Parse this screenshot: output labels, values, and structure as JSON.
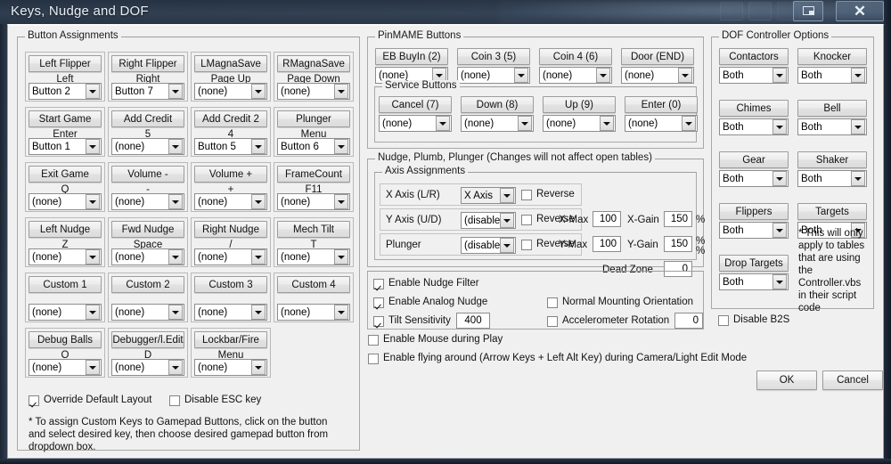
{
  "window": {
    "title": "Keys, Nudge and DOF",
    "buttons": {
      "minimize": "—",
      "maximize": "□",
      "extra": "⬜",
      "restore": "restore-icon",
      "close": "✕"
    }
  },
  "button_assignments": {
    "legend": "Button Assignments",
    "cells": [
      {
        "button": "Left Flipper",
        "key": "Left",
        "combo": "Button 2"
      },
      {
        "button": "Right Flipper",
        "key": "Right",
        "combo": "Button 7"
      },
      {
        "button": "LMagnaSave",
        "key": "Page Up",
        "combo": "(none)"
      },
      {
        "button": "RMagnaSave",
        "key": "Page Down",
        "combo": "(none)"
      },
      {
        "button": "Start Game",
        "key": "Enter",
        "combo": "Button 1"
      },
      {
        "button": "Add Credit",
        "key": "5",
        "combo": "(none)"
      },
      {
        "button": "Add Credit 2",
        "key": "4",
        "combo": "Button 5"
      },
      {
        "button": "Plunger",
        "key": "Menu",
        "combo": "Button 6"
      },
      {
        "button": "Exit Game",
        "key": "Q",
        "combo": "(none)"
      },
      {
        "button": "Volume -",
        "key": "-",
        "combo": "(none)"
      },
      {
        "button": "Volume +",
        "key": "+",
        "combo": "(none)"
      },
      {
        "button": "FrameCount",
        "key": "F11",
        "combo": "(none)"
      },
      {
        "button": "Left Nudge",
        "key": "Z",
        "combo": "(none)"
      },
      {
        "button": "Fwd Nudge",
        "key": "Space",
        "combo": "(none)"
      },
      {
        "button": "Right Nudge",
        "key": "/",
        "combo": "(none)"
      },
      {
        "button": "Mech Tilt",
        "key": "T",
        "combo": "(none)"
      },
      {
        "button": "Custom 1",
        "key": "",
        "combo": "(none)"
      },
      {
        "button": "Custom 2",
        "key": "",
        "combo": "(none)"
      },
      {
        "button": "Custom 3",
        "key": "",
        "combo": "(none)"
      },
      {
        "button": "Custom 4",
        "key": "",
        "combo": "(none)"
      },
      {
        "button": "Debug Balls",
        "key": "O",
        "combo": "(none)"
      },
      {
        "button": "Debugger/l.Edit",
        "key": "D",
        "combo": "(none)"
      },
      {
        "button": "Lockbar/Fire",
        "key": "Menu",
        "combo": "(none)"
      }
    ],
    "override_default_layout": {
      "label": "Override Default Layout",
      "checked": true
    },
    "disable_esc_key": {
      "label": "Disable ESC key",
      "checked": false
    },
    "note": "* To assign Custom Keys to Gamepad Buttons, click on the button and select desired key, then choose desired gamepad button from dropdown box."
  },
  "pinmame": {
    "legend": "PinMAME Buttons",
    "cells": [
      {
        "button": "EB BuyIn (2)",
        "combo": "(none)"
      },
      {
        "button": "Coin 3 (5)",
        "combo": "(none)"
      },
      {
        "button": "Coin 4 (6)",
        "combo": "(none)"
      },
      {
        "button": "Door (END)",
        "combo": "(none)"
      }
    ],
    "service": {
      "legend": "Service Buttons",
      "cells": [
        {
          "button": "Cancel (7)",
          "combo": "(none)"
        },
        {
          "button": "Down (8)",
          "combo": "(none)"
        },
        {
          "button": "Up (9)",
          "combo": "(none)"
        },
        {
          "button": "Enter (0)",
          "combo": "(none)"
        }
      ]
    }
  },
  "nudge": {
    "legend": "Nudge, Plumb, Plunger (Changes will not affect open tables)",
    "axis_legend": "Axis Assignments",
    "rows": [
      {
        "label": "X Axis (L/R)",
        "combo": "X Axis",
        "reverse_label": "Reverse",
        "reverse": false
      },
      {
        "label": "Y Axis (U/D)",
        "combo": "(disabled)",
        "reverse_label": "Reverse",
        "reverse": false
      },
      {
        "label": "Plunger",
        "combo": "(disabled)",
        "reverse_label": "Reverse",
        "reverse": false
      }
    ],
    "xmax_label": "X-Max",
    "xmax_value": "100",
    "xgain_label": "X-Gain",
    "xgain_value": "150",
    "xgain_unit": "%",
    "ymax_label": "Y-Max",
    "ymax_value": "100",
    "ygain_label": "Y-Gain",
    "ygain_value": "150",
    "ygain_unit": "%",
    "ygain_unit2": "%",
    "deadzone_label": "Dead Zone",
    "deadzone_value": "0",
    "enable_nudge_filter": {
      "label": "Enable Nudge Filter",
      "checked": true
    },
    "enable_analog_nudge": {
      "label": "Enable Analog Nudge",
      "checked": true
    },
    "tilt_sensitivity": {
      "label": "Tilt Sensitivity",
      "checked": true,
      "value": "400"
    },
    "normal_mounting": {
      "label": "Normal Mounting Orientation",
      "checked": false
    },
    "accel_rotation": {
      "label": "Accelerometer Rotation",
      "checked": false,
      "value": "0"
    },
    "enable_mouse": {
      "label": "Enable Mouse during Play",
      "checked": false
    },
    "enable_flying": {
      "label": "Enable flying around (Arrow Keys + Left Alt Key) during Camera/Light Edit Mode",
      "checked": false
    }
  },
  "dof": {
    "legend": "DOF Controller Options",
    "cells": [
      {
        "button": "Contactors",
        "combo": "Both"
      },
      {
        "button": "Knocker",
        "combo": "Both"
      },
      {
        "button": "Chimes",
        "combo": "Both"
      },
      {
        "button": "Bell",
        "combo": "Both"
      },
      {
        "button": "Gear",
        "combo": "Both"
      },
      {
        "button": "Shaker",
        "combo": "Both"
      },
      {
        "button": "Flippers",
        "combo": "Both"
      },
      {
        "button": "Targets",
        "combo": "Both"
      },
      {
        "button": "Drop Targets",
        "combo": "Both"
      }
    ],
    "note": "* This will only apply to tables that are using the Controller.vbs in their script code",
    "disable_b2s": {
      "label": "Disable B2S",
      "checked": false
    }
  },
  "footer": {
    "ok": "OK",
    "cancel": "Cancel"
  }
}
